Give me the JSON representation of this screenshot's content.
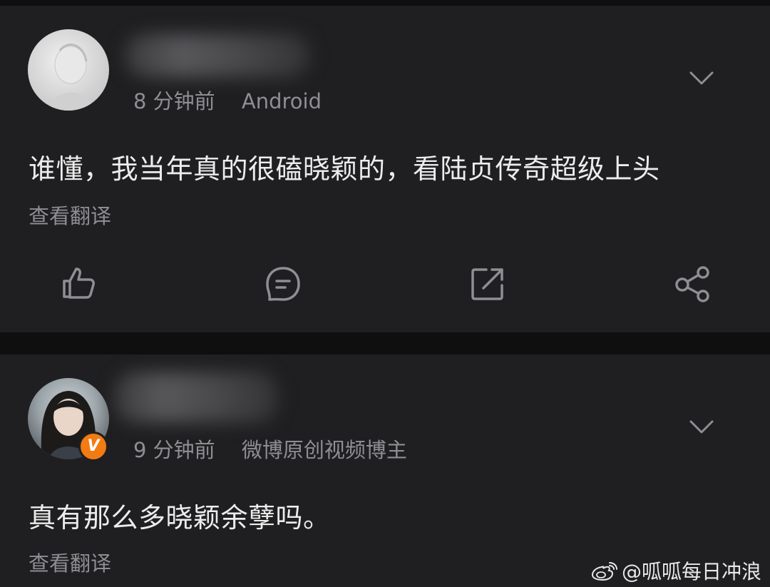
{
  "comments": [
    {
      "time": "8 分钟前",
      "source": "Android",
      "text": "谁懂，我当年真的很磕晓颖的，看陆贞传奇超级上头",
      "translate": "查看翻译"
    },
    {
      "time": "9 分钟前",
      "source": "微博原创视频博主",
      "text": "真有那么多晓颖余孽吗。",
      "translate": "查看翻译",
      "badge": "V"
    }
  ],
  "watermark": "@呱呱每日冲浪",
  "icons": {
    "like": "thumbs-up-icon",
    "comment": "comment-icon",
    "repost": "repost-icon",
    "share": "share-icon",
    "chevron": "chevron-down-icon"
  },
  "colors": {
    "background": "#0f0f0f",
    "card": "#1f1f21",
    "text": "#ececec",
    "muted": "#8e8e93",
    "accent": "#f27b13"
  }
}
